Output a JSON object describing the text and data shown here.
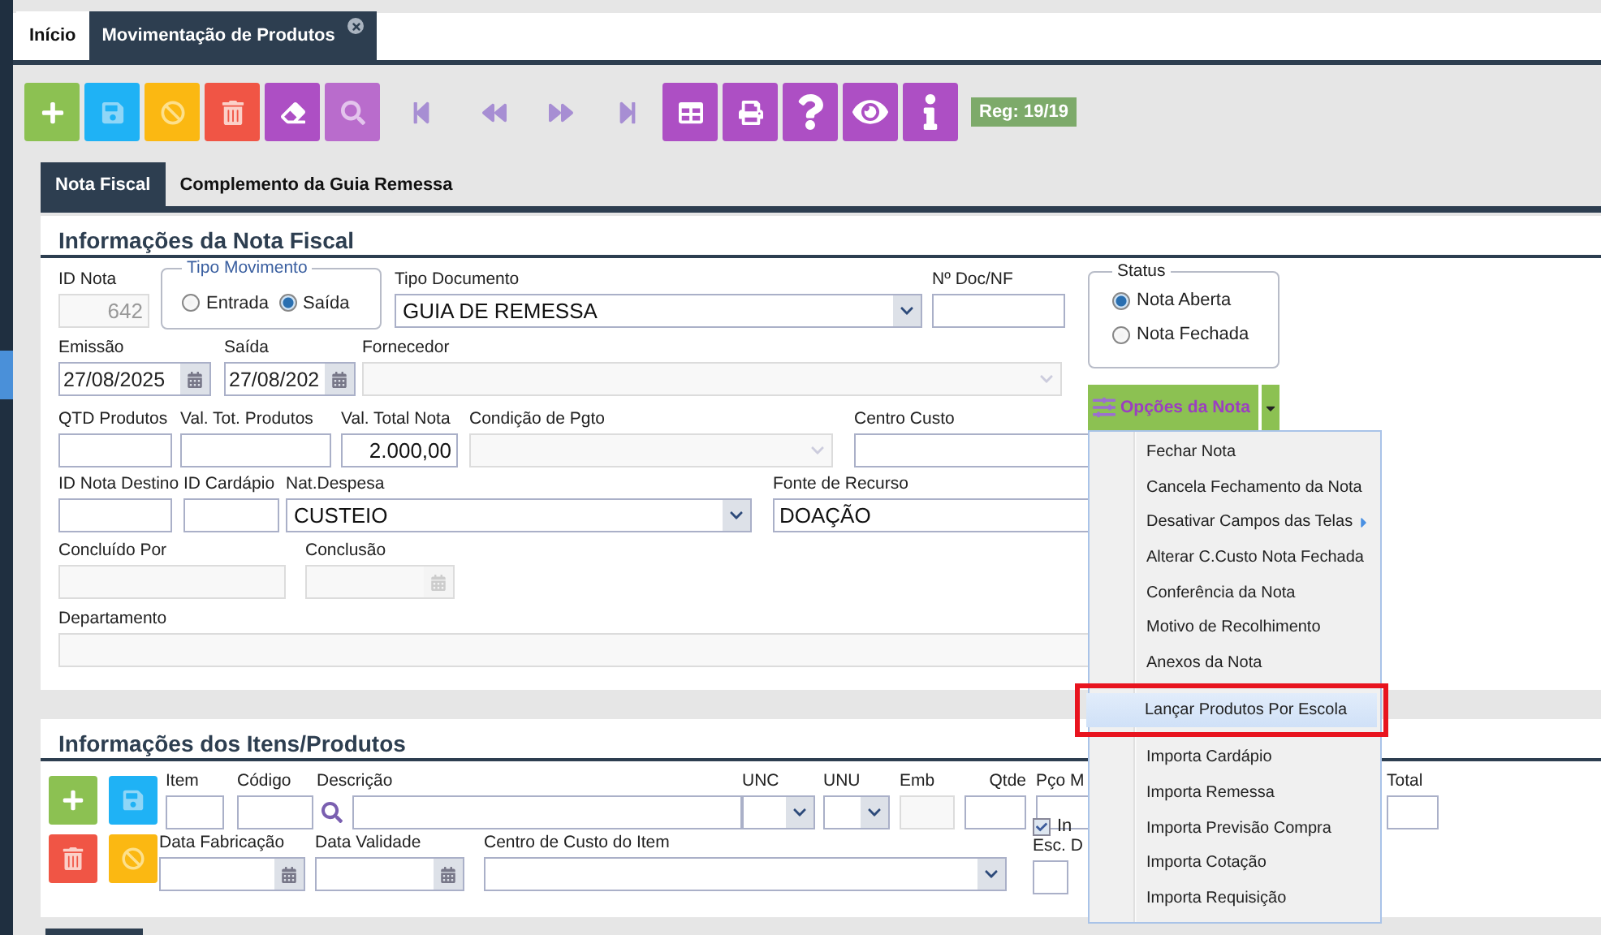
{
  "tabs": [
    {
      "label": "Início",
      "selected": false,
      "closable": false
    },
    {
      "label": "Movimentação de Produtos",
      "selected": true,
      "closable": true
    }
  ],
  "toolbar": [
    {
      "kind": "add"
    },
    {
      "kind": "save"
    },
    {
      "kind": "cancel"
    },
    {
      "kind": "delete"
    },
    {
      "kind": "clear"
    },
    {
      "kind": "search"
    },
    {
      "kind": "first"
    },
    {
      "kind": "previous"
    },
    {
      "kind": "next"
    },
    {
      "kind": "last"
    },
    {
      "kind": "grid"
    },
    {
      "kind": "print"
    },
    {
      "kind": "help"
    },
    {
      "kind": "view"
    },
    {
      "kind": "info"
    }
  ],
  "record_badge": "Reg: 19/19",
  "subtabs": [
    {
      "label": "Nota Fiscal",
      "selected": true
    },
    {
      "label": "Complemento da Guia Remessa",
      "selected": false
    }
  ],
  "nota_fiscal": {
    "title": "Informações da Nota Fiscal",
    "id_nota": {
      "label": "ID Nota",
      "value": "642",
      "kind": "text",
      "disabled": true
    },
    "tipo_movimento": {
      "legend": "Tipo Movimento",
      "options": [
        {
          "label": "Entrada",
          "selected": false
        },
        {
          "label": "Saída",
          "selected": true
        }
      ]
    },
    "tipo_documento": {
      "label": "Tipo Documento",
      "value": "GUIA DE REMESSA",
      "kind": "select",
      "disabled": false
    },
    "num_doc": {
      "label": "Nº Doc/NF",
      "kind": "text",
      "disabled": false
    },
    "status": {
      "legend": "Status",
      "options": [
        {
          "label": "Nota Aberta",
          "selected": true
        },
        {
          "label": "Nota Fechada",
          "selected": false
        }
      ]
    },
    "row_2": [
      {
        "label": "Emissão",
        "value": "27/08/2025",
        "kind": "date",
        "disabled": false
      },
      {
        "label": "Saída",
        "value": "27/08/202",
        "kind": "date",
        "disabled": false
      },
      {
        "label": "Fornecedor",
        "kind": "select",
        "disabled": true
      }
    ],
    "row_3": [
      {
        "label": "QTD Produtos",
        "kind": "text",
        "disabled": false
      },
      {
        "label": "Val. Tot. Produtos",
        "kind": "text",
        "disabled": false
      },
      {
        "label": "Val. Total Nota",
        "value": "2.000,00",
        "kind": "text",
        "disabled": false
      },
      {
        "label": "Condição de Pgto",
        "kind": "select",
        "disabled": true
      },
      {
        "label": "Centro Custo",
        "kind": "text",
        "disabled": false
      }
    ],
    "row_4": [
      {
        "label": "ID Nota Destino",
        "kind": "text",
        "disabled": false
      },
      {
        "label": "ID Cardápio",
        "kind": "text",
        "disabled": false
      },
      {
        "label": "Nat.Despesa",
        "value": "CUSTEIO",
        "kind": "select",
        "disabled": false
      },
      {
        "label": "Fonte de Recurso",
        "value": "DOAÇÃO",
        "kind": "text",
        "disabled": false
      }
    ],
    "row_5": [
      {
        "label": "Concluído Por",
        "kind": "text",
        "disabled": true
      },
      {
        "label": "Conclusão",
        "kind": "date",
        "disabled": true
      }
    ],
    "row_6": [
      {
        "label": "Departamento",
        "kind": "text",
        "disabled": true
      }
    ]
  },
  "options_menu": {
    "label": "Opções da Nota",
    "items": [
      {
        "label": "Fechar Nota",
        "selected": false,
        "submenu": false,
        "marked": false
      },
      {
        "label": "Cancela Fechamento da Nota",
        "selected": false,
        "submenu": false,
        "marked": false
      },
      {
        "label": "Desativar Campos das Telas",
        "selected": false,
        "submenu": true,
        "marked": false
      },
      {
        "label": "Alterar C.Custo Nota Fechada",
        "selected": false,
        "submenu": false,
        "marked": false
      },
      {
        "label": "Conferência da Nota",
        "selected": false,
        "submenu": false,
        "marked": false
      },
      {
        "label": "Motivo de Recolhimento",
        "selected": false,
        "submenu": false,
        "marked": false
      },
      {
        "label": "Anexos da Nota",
        "selected": false,
        "submenu": false,
        "marked": false
      },
      {
        "label": "Lançar Produtos Por Escola",
        "selected": true,
        "submenu": false,
        "marked": true
      },
      {
        "label": "Importa Cardápio",
        "selected": false,
        "submenu": false,
        "marked": false
      },
      {
        "label": "Importa Remessa",
        "selected": false,
        "submenu": false,
        "marked": false
      },
      {
        "label": "Importa Previsão Compra",
        "selected": false,
        "submenu": false,
        "marked": false
      },
      {
        "label": "Importa Cotação",
        "selected": false,
        "submenu": false,
        "marked": false
      },
      {
        "label": "Importa Requisição",
        "selected": false,
        "submenu": false,
        "marked": false
      }
    ]
  },
  "itens": {
    "title": "Informações dos Itens/Produtos",
    "buttons": [
      {
        "kind": "add"
      },
      {
        "kind": "save"
      },
      {
        "kind": "delete"
      },
      {
        "kind": "cancel"
      }
    ],
    "row_1": [
      {
        "label": "Item",
        "kind": "text",
        "disabled": false
      },
      {
        "label": "Código",
        "kind": "text",
        "disabled": false
      },
      {
        "label": "Descrição",
        "kind": "search",
        "disabled": false
      },
      {
        "label": "UNC",
        "kind": "select",
        "disabled": false
      },
      {
        "label": "UNU",
        "kind": "select",
        "disabled": false
      },
      {
        "label": "Emb",
        "kind": "text",
        "disabled": true
      },
      {
        "label": "Qtde",
        "kind": "text",
        "disabled": false
      },
      {
        "label": "Pço M",
        "kind": "text",
        "disabled": false
      }
    ],
    "total": {
      "label": "Total",
      "kind": "text",
      "disabled": false
    },
    "row_2": [
      {
        "label": "Data Fabricação",
        "kind": "date",
        "disabled": false
      },
      {
        "label": "Data Validade",
        "kind": "date",
        "disabled": false
      },
      {
        "label": "Centro de Custo do Item",
        "kind": "select",
        "disabled": false
      }
    ],
    "check": {
      "label": "In",
      "checked": true
    },
    "esc": {
      "label": "Esc. D",
      "kind": "text",
      "disabled": false
    }
  }
}
